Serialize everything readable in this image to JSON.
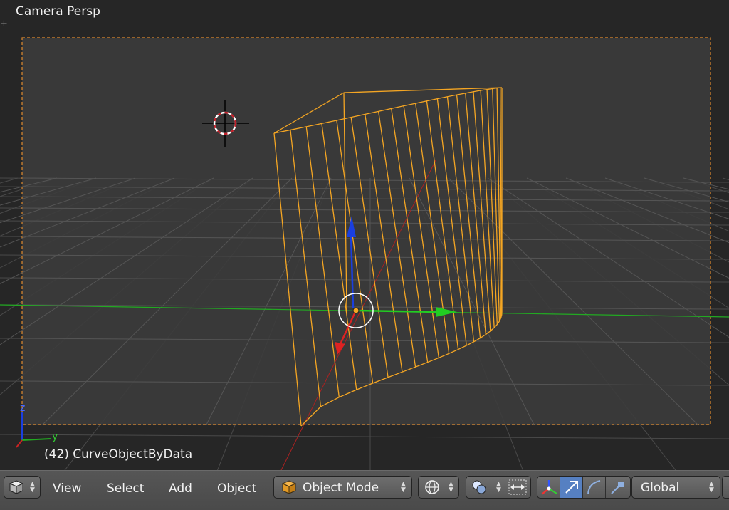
{
  "viewport": {
    "title": "Camera Persp",
    "object_label": "(42) CurveObjectByData",
    "axis_labels": {
      "z": "z",
      "y": "y"
    }
  },
  "header": {
    "menu": [
      "View",
      "Select",
      "Add",
      "Object"
    ],
    "mode_label": "Object Mode",
    "orientation_label": "Global"
  },
  "colors": {
    "selection": "#f5a623",
    "camera_border": "#e08a2e",
    "x_axis": "#cc2222",
    "y_axis": "#22aa22",
    "z_axis": "#1a3fe0",
    "active_tool": "#5680c2"
  },
  "icons": {
    "editor_type": "cube-icon",
    "mode": "object-cube-icon",
    "shading": "sphere-wire-icon",
    "pivot": "pivot-spheres-icon",
    "snap": "snap-arrows-icon",
    "manipulator": "axes-manipulator-icon",
    "translate": "translate-arrow-icon",
    "rotate": "rotate-arc-icon",
    "scale": "scale-icon"
  }
}
